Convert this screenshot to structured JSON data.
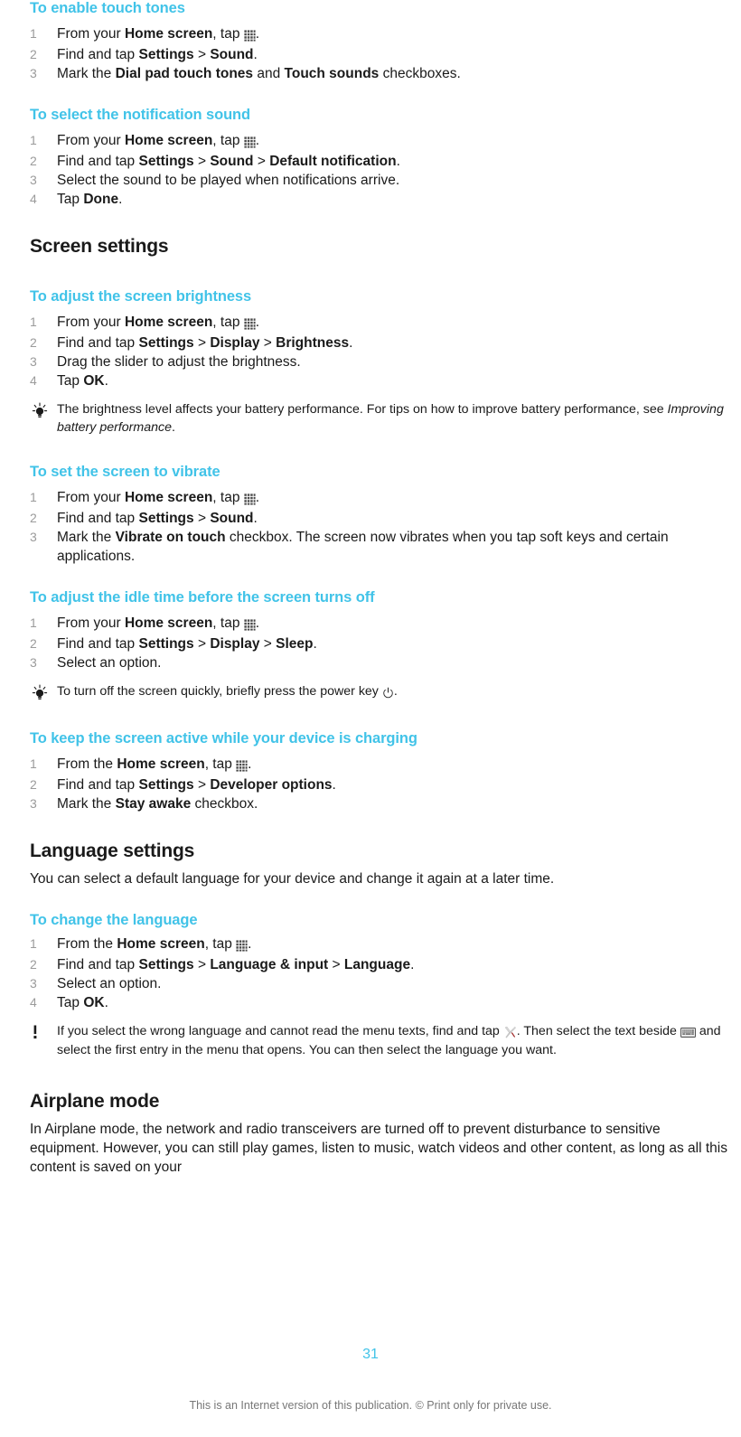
{
  "page": {
    "number": "31",
    "footer_note": "This is an Internet version of this publication. © Print only for private use."
  },
  "icons": {
    "app_drawer": "app-drawer-grid-icon",
    "power_key": "power-key-icon",
    "tools": "tools-wrench-screwdriver-icon",
    "keyboard": "keyboard-icon",
    "tip": "lightbulb-tip-icon",
    "warning": "exclamation-warning-icon"
  },
  "colors": {
    "heading_accent": "#41c3e8",
    "body_text": "#1a1a1a",
    "step_number": "#9b9b9b",
    "footer_text": "#777777"
  },
  "sections": {
    "touch_tones": {
      "title": "To enable touch tones",
      "steps": {
        "s1_a": "From your ",
        "s1_home": "Home screen",
        "s1_b": ", tap ",
        "s1_c": ".",
        "s2_a": "Find and tap ",
        "s2_settings": "Settings",
        "s2_sep": " > ",
        "s2_sound": "Sound",
        "s2_end": ".",
        "s3_a": "Mark the ",
        "s3_b1": "Dial pad touch tones",
        "s3_b": " and ",
        "s3_b2": "Touch sounds",
        "s3_c": " checkboxes."
      },
      "nums": {
        "n1": "1",
        "n2": "2",
        "n3": "3"
      }
    },
    "notification_sound": {
      "title": "To select the notification sound",
      "steps": {
        "s1_a": "From your ",
        "s1_home": "Home screen",
        "s1_b": ", tap ",
        "s1_c": ".",
        "s2_a": "Find and tap ",
        "s2_settings": "Settings",
        "s2_sep1": " > ",
        "s2_sound": "Sound",
        "s2_sep2": " > ",
        "s2_default": "Default notification",
        "s2_end": ".",
        "s3": "Select the sound to be played when notifications arrive.",
        "s4_a": "Tap ",
        "s4_done": "Done",
        "s4_end": "."
      },
      "nums": {
        "n1": "1",
        "n2": "2",
        "n3": "3",
        "n4": "4"
      }
    },
    "screen_settings": {
      "title": "Screen settings"
    },
    "brightness": {
      "title": "To adjust the screen brightness",
      "steps": {
        "s1_a": "From your ",
        "s1_home": "Home screen",
        "s1_b": ", tap ",
        "s1_c": ".",
        "s2_a": "Find and tap ",
        "s2_settings": "Settings",
        "s2_sep1": " > ",
        "s2_display": "Display",
        "s2_sep2": " > ",
        "s2_brightness": "Brightness",
        "s2_end": ".",
        "s3": "Drag the slider to adjust the brightness.",
        "s4_a": "Tap ",
        "s4_ok": "OK",
        "s4_end": "."
      },
      "nums": {
        "n1": "1",
        "n2": "2",
        "n3": "3",
        "n4": "4"
      },
      "tip": {
        "text_a": "The brightness level affects your battery performance. For tips on how to improve battery performance, see ",
        "text_link": "Improving battery performance",
        "text_b": "."
      }
    },
    "vibrate": {
      "title": "To set the screen to vibrate",
      "steps": {
        "s1_a": "From your ",
        "s1_home": "Home screen",
        "s1_b": ", tap ",
        "s1_c": ".",
        "s2_a": "Find and tap ",
        "s2_settings": "Settings",
        "s2_sep": " > ",
        "s2_sound": "Sound",
        "s2_end": ".",
        "s3_a": "Mark the ",
        "s3_bold": "Vibrate on touch",
        "s3_b": " checkbox. The screen now vibrates when you tap soft keys and certain applications."
      },
      "nums": {
        "n1": "1",
        "n2": "2",
        "n3": "3"
      }
    },
    "idle_time": {
      "title": "To adjust the idle time before the screen turns off",
      "steps": {
        "s1_a": "From your ",
        "s1_home": "Home screen",
        "s1_b": ", tap ",
        "s1_c": ".",
        "s2_a": "Find and tap ",
        "s2_settings": "Settings",
        "s2_sep1": " > ",
        "s2_display": "Display",
        "s2_sep2": " > ",
        "s2_sleep": "Sleep",
        "s2_end": ".",
        "s3": "Select an option."
      },
      "nums": {
        "n1": "1",
        "n2": "2",
        "n3": "3"
      },
      "tip": {
        "text_a": "To turn off the screen quickly, briefly press the power key ",
        "text_b": "."
      }
    },
    "stay_awake": {
      "title": "To keep the screen active while your device is charging",
      "steps": {
        "s1_a": "From the ",
        "s1_home": "Home screen",
        "s1_b": ", tap ",
        "s1_c": ".",
        "s2_a": "Find and tap ",
        "s2_settings": "Settings",
        "s2_sep": " > ",
        "s2_dev": "Developer options",
        "s2_end": ".",
        "s3_a": "Mark the ",
        "s3_bold": "Stay awake",
        "s3_b": " checkbox."
      },
      "nums": {
        "n1": "1",
        "n2": "2",
        "n3": "3"
      }
    },
    "language_settings": {
      "title": "Language settings",
      "intro": "You can select a default language for your device and change it again at a later time."
    },
    "change_language": {
      "title": "To change the language",
      "steps": {
        "s1_a": "From the ",
        "s1_home": "Home screen",
        "s1_b": ", tap ",
        "s1_c": ".",
        "s2_a": "Find and tap ",
        "s2_settings": "Settings",
        "s2_sep1": " > ",
        "s2_lang_input": "Language & input",
        "s2_sep2": " > ",
        "s2_language": "Language",
        "s2_end": ".",
        "s3": "Select an option.",
        "s4_a": "Tap ",
        "s4_ok": "OK",
        "s4_end": "."
      },
      "nums": {
        "n1": "1",
        "n2": "2",
        "n3": "3",
        "n4": "4"
      },
      "warning": {
        "text_a": "If you select the wrong language and cannot read the menu texts, find and tap ",
        "text_b": ". Then select the text beside ",
        "text_c": " and select the first entry in the menu that opens. You can then select the language you want."
      }
    },
    "airplane_mode": {
      "title": "Airplane mode",
      "body": "In Airplane mode, the network and radio transceivers are turned off to prevent disturbance to sensitive equipment. However, you can still play games, listen to music, watch videos and other content, as long as all this content is saved on your"
    }
  }
}
